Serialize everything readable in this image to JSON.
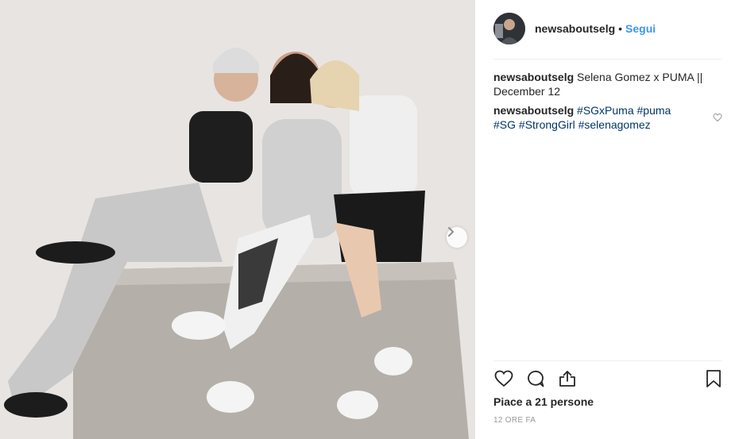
{
  "post": {
    "username": "newsaboutselg",
    "separator": "•",
    "follow_label": "Segui",
    "comments": [
      {
        "author": "newsaboutselg",
        "text": "Selena Gomez x PUMA || December 12"
      },
      {
        "author": "newsaboutselg",
        "hashtags": [
          "#SGxPuma",
          "#puma",
          "#SG",
          "#StrongGirl",
          "#selenagomez"
        ]
      }
    ],
    "likes_text": "Piace a 21 persone",
    "timestamp": "12 ORE FA"
  },
  "icons": {
    "like": "heart-icon",
    "comment": "comment-bubble-icon",
    "share": "share-icon",
    "save": "bookmark-icon",
    "carousel_next": "chevron-right-icon",
    "comment_like": "heart-small-icon"
  },
  "colors": {
    "link_blue": "#3897f0",
    "hashtag_blue": "#003569",
    "text": "#262626",
    "muted": "#999999",
    "divider": "#efefef"
  }
}
